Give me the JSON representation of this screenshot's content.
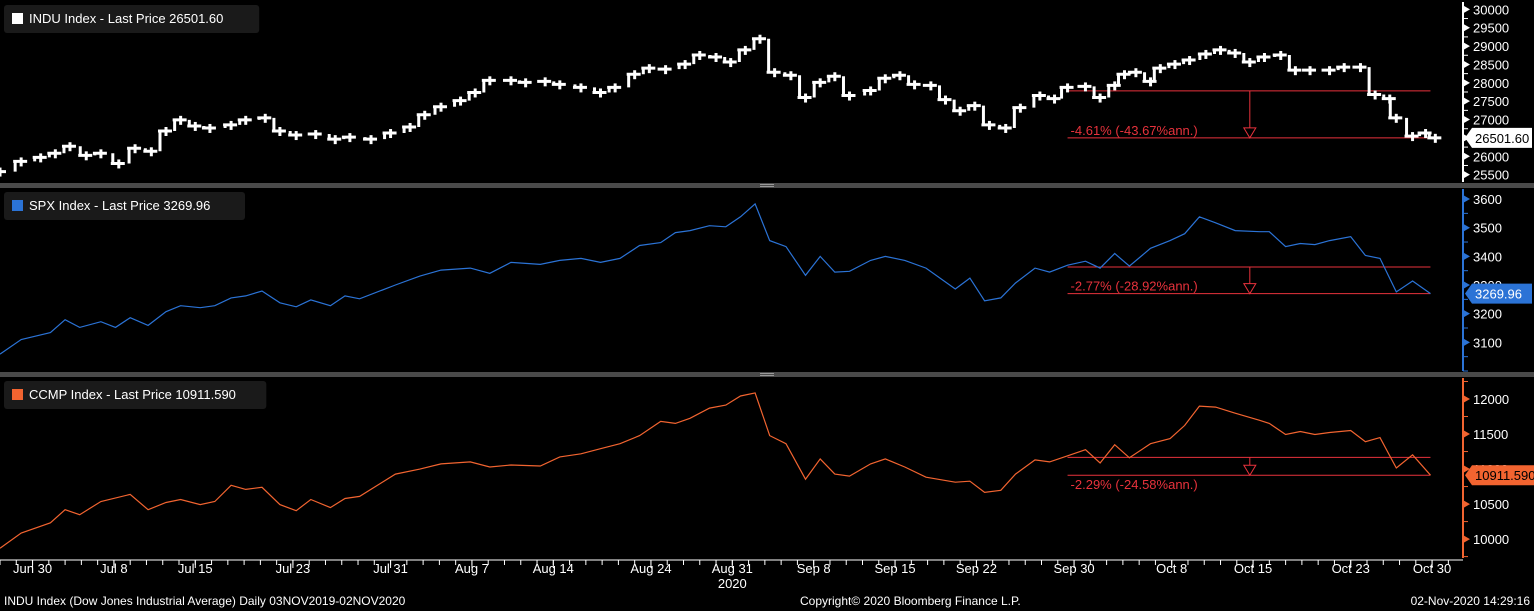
{
  "footer": {
    "left": "INDU Index (Dow Jones Industrial Average)  Daily 03NOV2019-02NOV2020",
    "center": "Copyright© 2020 Bloomberg Finance L.P.",
    "right": "02-Nov-2020 14:29:16"
  },
  "colors": {
    "indu": "#ffffff",
    "spx": "#2b73d6",
    "ccmp": "#f26430",
    "annotation": "#e8323c",
    "separator": "#4a4a4a"
  },
  "chart_data": {
    "type": "line",
    "xlabel": "",
    "x_units": "trading days since Jun 30 2020",
    "xlim": [
      -2,
      87.9
    ],
    "x_ticks": [
      {
        "t": 0,
        "label": "Jun 30"
      },
      {
        "t": 5,
        "label": "Jul 8"
      },
      {
        "t": 10,
        "label": "Jul 15"
      },
      {
        "t": 16,
        "label": "Jul 23"
      },
      {
        "t": 22,
        "label": "Jul 31"
      },
      {
        "t": 27,
        "label": "Aug 7"
      },
      {
        "t": 32,
        "label": "Aug 14"
      },
      {
        "t": 38,
        "label": "Aug 24"
      },
      {
        "t": 43,
        "label": "Aug 31"
      },
      {
        "t": 48,
        "label": "Sep 8"
      },
      {
        "t": 53,
        "label": "Sep 15"
      },
      {
        "t": 58,
        "label": "Sep 22"
      },
      {
        "t": 64,
        "label": "Sep 30"
      },
      {
        "t": 70,
        "label": "Oct 8"
      },
      {
        "t": 75,
        "label": "Oct 15"
      },
      {
        "t": 81,
        "label": "Oct 23"
      },
      {
        "t": 86,
        "label": "Oct 30"
      }
    ],
    "year_label": {
      "t": 43,
      "label": "2020"
    },
    "panels": [
      {
        "id": "indu",
        "style": "bar",
        "legend": "INDU Index - Last Price 26501.60",
        "last_price": "26501.60",
        "last_value": 26501.6,
        "ylim": [
          25300,
          30200
        ],
        "y_ticks": [
          25500,
          26000,
          26500,
          27000,
          27500,
          28000,
          28500,
          29000,
          29500,
          30000
        ],
        "y_tick_labels": [
          "25500",
          "26000",
          "26500",
          "27000",
          "27500",
          "28000",
          "28500",
          "29000",
          "29500",
          "30000"
        ],
        "annotation": {
          "label": "-4.61% (-43.67%ann.)",
          "from_t": 63.6,
          "to_t": 85.9,
          "arrow_t": 74.8,
          "start_value": 27781,
          "end_value": 26501.6
        },
        "points": [
          [
            -2.0,
            25584
          ],
          [
            -0.7,
            25860
          ],
          [
            0.5,
            25970
          ],
          [
            1.4,
            26081
          ],
          [
            2.3,
            26274
          ],
          [
            3.3,
            26026
          ],
          [
            4.2,
            26081
          ],
          [
            5.3,
            25805
          ],
          [
            6.3,
            26219
          ],
          [
            7.3,
            26136
          ],
          [
            8.2,
            26688
          ],
          [
            9.1,
            26992
          ],
          [
            10.0,
            26826
          ],
          [
            10.9,
            26771
          ],
          [
            12.2,
            26854
          ],
          [
            13.1,
            26992
          ],
          [
            14.3,
            27047
          ],
          [
            15.2,
            26688
          ],
          [
            16.2,
            26578
          ],
          [
            17.4,
            26605
          ],
          [
            18.6,
            26467
          ],
          [
            19.5,
            26522
          ],
          [
            20.8,
            26467
          ],
          [
            22.0,
            26633
          ],
          [
            23.2,
            26798
          ],
          [
            24.1,
            27130
          ],
          [
            25.1,
            27350
          ],
          [
            26.3,
            27516
          ],
          [
            27.2,
            27737
          ],
          [
            28.1,
            28068
          ],
          [
            29.4,
            28068
          ],
          [
            30.3,
            28013
          ],
          [
            31.5,
            28040
          ],
          [
            32.4,
            27958
          ],
          [
            33.7,
            27875
          ],
          [
            34.9,
            27737
          ],
          [
            35.8,
            27875
          ],
          [
            37.0,
            28234
          ],
          [
            37.9,
            28399
          ],
          [
            38.9,
            28372
          ],
          [
            40.1,
            28510
          ],
          [
            41.0,
            28758
          ],
          [
            42.0,
            28703
          ],
          [
            42.9,
            28565
          ],
          [
            43.8,
            28896
          ],
          [
            44.7,
            29200
          ],
          [
            45.6,
            28289
          ],
          [
            46.6,
            28206
          ],
          [
            47.5,
            27599
          ],
          [
            48.4,
            28013
          ],
          [
            49.3,
            28179
          ],
          [
            50.2,
            27654
          ],
          [
            51.5,
            27792
          ],
          [
            52.4,
            28123
          ],
          [
            53.3,
            28206
          ],
          [
            54.2,
            27958
          ],
          [
            55.2,
            27930
          ],
          [
            56.1,
            27544
          ],
          [
            57.0,
            27240
          ],
          [
            57.9,
            27378
          ],
          [
            58.8,
            26854
          ],
          [
            59.8,
            26771
          ],
          [
            60.7,
            27323
          ],
          [
            61.9,
            27654
          ],
          [
            62.8,
            27571
          ],
          [
            63.6,
            27875
          ],
          [
            64.7,
            27902
          ],
          [
            65.6,
            27599
          ],
          [
            66.5,
            27930
          ],
          [
            67.1,
            28234
          ],
          [
            67.8,
            28289
          ],
          [
            68.7,
            28040
          ],
          [
            69.3,
            28399
          ],
          [
            70.2,
            28510
          ],
          [
            71.1,
            28620
          ],
          [
            72.1,
            28786
          ],
          [
            73.0,
            28896
          ],
          [
            73.9,
            28813
          ],
          [
            74.8,
            28565
          ],
          [
            75.7,
            28703
          ],
          [
            76.7,
            28758
          ],
          [
            77.6,
            28344
          ],
          [
            78.5,
            28344
          ],
          [
            79.7,
            28344
          ],
          [
            80.6,
            28427
          ],
          [
            81.6,
            28427
          ],
          [
            82.5,
            27682
          ],
          [
            83.4,
            27571
          ],
          [
            83.8,
            27047
          ],
          [
            84.8,
            26550
          ],
          [
            85.6,
            26633
          ],
          [
            86.2,
            26502
          ]
        ]
      },
      {
        "id": "spx",
        "style": "line",
        "legend": "SPX Index - Last Price 3269.96",
        "last_price": "3269.96",
        "last_value": 3269.96,
        "ylim": [
          3000,
          3635
        ],
        "y_ticks": [
          3100,
          3200,
          3300,
          3400,
          3500,
          3600
        ],
        "y_tick_labels": [
          "3100",
          "3200",
          "3300",
          "3400",
          "3500",
          "3600"
        ],
        "annotation": {
          "label": "-2.77% (-28.92%ann.)",
          "from_t": 63.6,
          "to_t": 85.9,
          "arrow_t": 74.8,
          "start_value": 3363,
          "end_value": 3269.96
        },
        "points": [
          [
            -2.0,
            3059
          ],
          [
            -0.7,
            3110
          ],
          [
            1.1,
            3134
          ],
          [
            2.0,
            3179
          ],
          [
            2.9,
            3152
          ],
          [
            4.2,
            3172
          ],
          [
            5.1,
            3152
          ],
          [
            6.0,
            3186
          ],
          [
            7.1,
            3159
          ],
          [
            8.2,
            3207
          ],
          [
            9.1,
            3228
          ],
          [
            10.3,
            3221
          ],
          [
            11.2,
            3228
          ],
          [
            12.2,
            3255
          ],
          [
            13.1,
            3262
          ],
          [
            14.1,
            3279
          ],
          [
            15.2,
            3238
          ],
          [
            16.2,
            3224
          ],
          [
            17.1,
            3248
          ],
          [
            18.3,
            3228
          ],
          [
            19.2,
            3262
          ],
          [
            20.1,
            3252
          ],
          [
            22.3,
            3300
          ],
          [
            23.8,
            3331
          ],
          [
            25.1,
            3352
          ],
          [
            26.9,
            3359
          ],
          [
            28.1,
            3341
          ],
          [
            29.4,
            3379
          ],
          [
            31.2,
            3372
          ],
          [
            32.4,
            3386
          ],
          [
            33.7,
            3393
          ],
          [
            34.9,
            3379
          ],
          [
            36.1,
            3393
          ],
          [
            37.3,
            3438
          ],
          [
            38.6,
            3448
          ],
          [
            39.5,
            3483
          ],
          [
            40.4,
            3490
          ],
          [
            41.6,
            3507
          ],
          [
            42.6,
            3503
          ],
          [
            43.5,
            3538
          ],
          [
            44.4,
            3583
          ],
          [
            45.3,
            3455
          ],
          [
            46.3,
            3434
          ],
          [
            47.5,
            3334
          ],
          [
            48.4,
            3400
          ],
          [
            49.3,
            3345
          ],
          [
            50.2,
            3348
          ],
          [
            51.5,
            3386
          ],
          [
            52.4,
            3400
          ],
          [
            53.6,
            3386
          ],
          [
            54.9,
            3359
          ],
          [
            56.7,
            3286
          ],
          [
            57.6,
            3324
          ],
          [
            58.5,
            3245
          ],
          [
            59.5,
            3255
          ],
          [
            60.4,
            3307
          ],
          [
            61.6,
            3359
          ],
          [
            62.5,
            3345
          ],
          [
            63.6,
            3369
          ],
          [
            64.7,
            3383
          ],
          [
            65.6,
            3359
          ],
          [
            66.5,
            3410
          ],
          [
            67.4,
            3366
          ],
          [
            68.7,
            3428
          ],
          [
            69.9,
            3455
          ],
          [
            70.8,
            3479
          ],
          [
            71.7,
            3538
          ],
          [
            72.7,
            3517
          ],
          [
            73.9,
            3490
          ],
          [
            75.4,
            3486
          ],
          [
            76.0,
            3486
          ],
          [
            77.0,
            3434
          ],
          [
            77.9,
            3445
          ],
          [
            78.8,
            3441
          ],
          [
            79.7,
            3455
          ],
          [
            81.0,
            3469
          ],
          [
            81.9,
            3403
          ],
          [
            82.8,
            3393
          ],
          [
            83.8,
            3276
          ],
          [
            84.8,
            3314
          ],
          [
            85.9,
            3270
          ]
        ]
      },
      {
        "id": "ccmp",
        "style": "line",
        "legend": "CCMP Index - Last Price 10911.590",
        "last_price": "10911.590",
        "last_value": 10911.59,
        "ylim": [
          9730,
          12300
        ],
        "y_ticks": [
          10000,
          10500,
          11000,
          11500,
          12000
        ],
        "y_tick_labels": [
          "10000",
          "10500",
          "11000",
          "11500",
          "12000"
        ],
        "annotation": {
          "label": "-2.29% (-24.58%ann.)",
          "from_t": 63.6,
          "to_t": 85.9,
          "arrow_t": 74.8,
          "start_value": 11167,
          "end_value": 10911.59
        },
        "points": [
          [
            -2.0,
            9870
          ],
          [
            -0.7,
            10087
          ],
          [
            1.1,
            10232
          ],
          [
            2.0,
            10420
          ],
          [
            2.9,
            10348
          ],
          [
            4.2,
            10536
          ],
          [
            6.0,
            10638
          ],
          [
            7.1,
            10420
          ],
          [
            8.2,
            10522
          ],
          [
            9.1,
            10565
          ],
          [
            10.3,
            10493
          ],
          [
            11.2,
            10536
          ],
          [
            12.2,
            10768
          ],
          [
            13.1,
            10710
          ],
          [
            14.1,
            10739
          ],
          [
            15.2,
            10493
          ],
          [
            16.2,
            10406
          ],
          [
            17.1,
            10565
          ],
          [
            18.3,
            10449
          ],
          [
            19.2,
            10580
          ],
          [
            20.1,
            10609
          ],
          [
            22.3,
            10928
          ],
          [
            23.8,
            11000
          ],
          [
            25.1,
            11073
          ],
          [
            26.9,
            11102
          ],
          [
            28.1,
            11029
          ],
          [
            29.4,
            11058
          ],
          [
            31.2,
            11044
          ],
          [
            32.4,
            11174
          ],
          [
            33.7,
            11218
          ],
          [
            34.9,
            11290
          ],
          [
            36.1,
            11362
          ],
          [
            37.3,
            11478
          ],
          [
            38.6,
            11681
          ],
          [
            39.5,
            11652
          ],
          [
            40.4,
            11725
          ],
          [
            41.6,
            11870
          ],
          [
            42.6,
            11913
          ],
          [
            43.5,
            12043
          ],
          [
            44.4,
            12087
          ],
          [
            45.3,
            11478
          ],
          [
            46.3,
            11362
          ],
          [
            47.5,
            10855
          ],
          [
            48.4,
            11145
          ],
          [
            49.3,
            10928
          ],
          [
            50.2,
            10899
          ],
          [
            51.5,
            11073
          ],
          [
            52.4,
            11145
          ],
          [
            53.6,
            11029
          ],
          [
            54.9,
            10884
          ],
          [
            56.7,
            10812
          ],
          [
            57.6,
            10826
          ],
          [
            58.5,
            10667
          ],
          [
            59.5,
            10696
          ],
          [
            60.4,
            10928
          ],
          [
            61.6,
            11131
          ],
          [
            62.5,
            11102
          ],
          [
            63.6,
            11189
          ],
          [
            64.7,
            11276
          ],
          [
            65.6,
            11087
          ],
          [
            66.5,
            11348
          ],
          [
            67.4,
            11160
          ],
          [
            68.7,
            11362
          ],
          [
            69.9,
            11435
          ],
          [
            70.8,
            11623
          ],
          [
            71.7,
            11899
          ],
          [
            72.7,
            11884
          ],
          [
            73.9,
            11797
          ],
          [
            75.4,
            11696
          ],
          [
            76.0,
            11652
          ],
          [
            77.0,
            11493
          ],
          [
            77.9,
            11536
          ],
          [
            78.8,
            11493
          ],
          [
            79.7,
            11522
          ],
          [
            81.0,
            11551
          ],
          [
            81.9,
            11391
          ],
          [
            82.8,
            11449
          ],
          [
            83.8,
            11015
          ],
          [
            84.8,
            11203
          ],
          [
            85.9,
            10912
          ]
        ]
      }
    ]
  }
}
